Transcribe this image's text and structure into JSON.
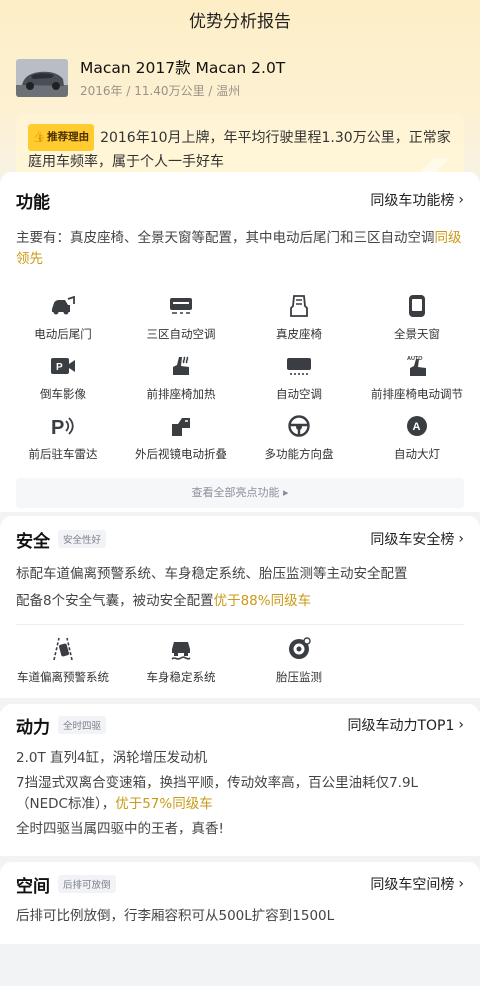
{
  "nav": {
    "title": "优势分析报告"
  },
  "car": {
    "name": "Macan 2017款 Macan 2.0T",
    "meta": "2016年 / 11.40万公里 / 温州"
  },
  "reason": {
    "tag": "推荐理由",
    "text": "2016年10月上牌，年平均行驶里程1.30万公里，正常家庭用车频率，属于个人一手好车"
  },
  "function": {
    "title": "功能",
    "link": "同级车功能榜",
    "desc_prefix": "主要有：真皮座椅、全景天窗等配置，其中电动后尾门和三区自动空调",
    "desc_highlight": "同级领先",
    "features": [
      {
        "label": "电动后尾门",
        "icon": "tailgate-icon"
      },
      {
        "label": "三区自动空调",
        "icon": "climate-zone-icon"
      },
      {
        "label": "真皮座椅",
        "icon": "leather-seat-icon"
      },
      {
        "label": "全景天窗",
        "icon": "sunroof-icon"
      },
      {
        "label": "倒车影像",
        "icon": "reverse-camera-icon"
      },
      {
        "label": "前排座椅加热",
        "icon": "seat-heating-icon"
      },
      {
        "label": "自动空调",
        "icon": "auto-ac-icon"
      },
      {
        "label": "前排座椅电动调节",
        "icon": "seat-adjust-icon"
      },
      {
        "label": "前后驻车雷达",
        "icon": "parking-radar-icon"
      },
      {
        "label": "外后视镜电动折叠",
        "icon": "mirror-fold-icon"
      },
      {
        "label": "多功能方向盘",
        "icon": "steering-wheel-icon"
      },
      {
        "label": "自动大灯",
        "icon": "auto-headlight-icon"
      }
    ],
    "view_all": "查看全部亮点功能 ▸"
  },
  "safety": {
    "title": "安全",
    "badge": "安全性好",
    "link": "同级车安全榜",
    "desc1": "标配车道偏离预警系统、车身稳定系统、胎压监测等主动安全配置",
    "desc2_prefix": "配备8个安全气囊，被动安全配置",
    "desc2_highlight": "优于88%同级车",
    "features": [
      {
        "label": "车道偏离预警系统",
        "icon": "lane-departure-icon"
      },
      {
        "label": "车身稳定系统",
        "icon": "stability-control-icon"
      },
      {
        "label": "胎压监测",
        "icon": "tire-pressure-icon"
      }
    ]
  },
  "power": {
    "title": "动力",
    "badge": "全时四驱",
    "link": "同级车动力TOP1",
    "line1": "2.0T 直列4缸，涡轮增压发动机",
    "line2_prefix": "7挡湿式双离合变速箱，换挡平顺，传动效率高，百公里油耗仅7.9L（NEDC标准），",
    "line2_highlight": "优于57%同级车",
    "line3": "全时四驱当属四驱中的王者，真香!"
  },
  "space": {
    "title": "空间",
    "badge": "后排可放倒",
    "link": "同级车空间榜",
    "line1": "后排可比例放倒，行李厢容积可从500L扩容到1500L"
  },
  "colors": {
    "accent": "#c99a17",
    "tag": "#ffcb2f"
  }
}
